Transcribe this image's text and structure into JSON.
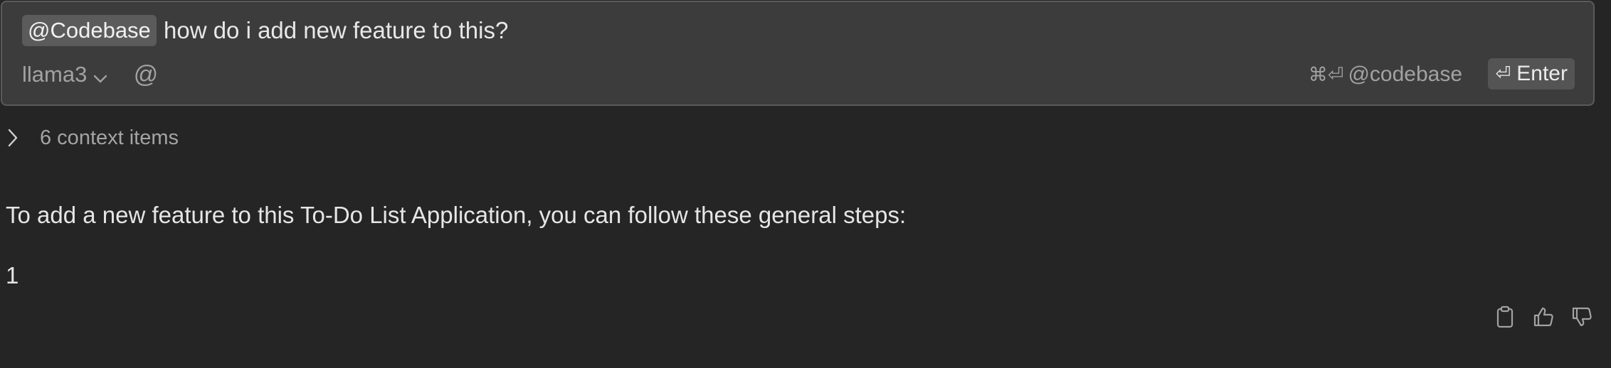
{
  "input": {
    "mention_chip": "@Codebase",
    "query": "how do i add new feature to this?",
    "model": "llama3",
    "at_symbol": "@",
    "shortcut_keys": "⌘⏎",
    "shortcut_label": "@codebase",
    "enter_glyph": "⏎",
    "enter_label": "Enter"
  },
  "context": {
    "label": "6 context items"
  },
  "response": {
    "intro": "To add a new feature to this To-Do List Application, you can follow these general steps:",
    "step": "1"
  },
  "icons": {
    "model_dropdown": "chevron-down-icon",
    "context_toggle": "chevron-right-icon",
    "copy": "clipboard-icon",
    "thumbs_up": "thumbs-up-icon",
    "thumbs_down": "thumbs-down-icon"
  },
  "colors": {
    "background": "#252525",
    "input_background": "#3c3c3c",
    "input_border": "#5a5a5a",
    "chip_background": "#5b5b5b",
    "muted_text": "#a2a2a2",
    "primary_text": "#e6e6e6"
  }
}
